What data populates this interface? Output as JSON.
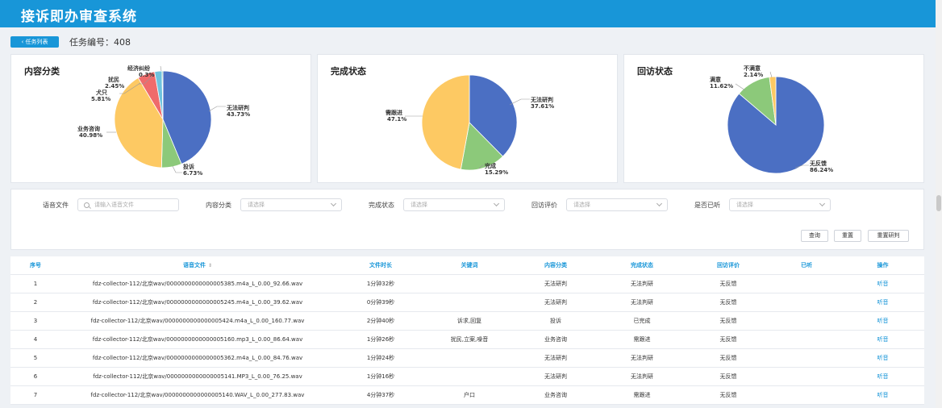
{
  "app": {
    "title": "接诉即办审查系统"
  },
  "toolbar": {
    "back_label": "任务列表",
    "back_icon": "chevron-left-icon",
    "task_id_label": "任务编号：408"
  },
  "colors": {
    "primary": "#1896d8",
    "blue": "#4b6fc3",
    "green": "#8cc97a",
    "yellow": "#fdc963",
    "red": "#ef6b6b",
    "cyan": "#6fc3de"
  },
  "charts": [
    {
      "title": "内容分类",
      "labels": [
        {
          "name": "无法研判",
          "pct": "43.73%"
        },
        {
          "name": "投诉",
          "pct": "6.73%"
        },
        {
          "name": "业务咨询",
          "pct": "40.98%"
        },
        {
          "name": "犬只",
          "pct": "5.81%"
        },
        {
          "name": "扰民",
          "pct": "2.45%"
        },
        {
          "name": "经济纠纷",
          "pct": "0.3%"
        }
      ]
    },
    {
      "title": "完成状态",
      "labels": [
        {
          "name": "无法研判",
          "pct": "37.61%"
        },
        {
          "name": "完成",
          "pct": "15.29%"
        },
        {
          "name": "需跟进",
          "pct": "47.1%"
        }
      ]
    },
    {
      "title": "回访状态",
      "labels": [
        {
          "name": "无反馈",
          "pct": "86.24%"
        },
        {
          "name": "满意",
          "pct": "11.62%"
        },
        {
          "name": "不满意",
          "pct": "2.14%"
        }
      ]
    }
  ],
  "chart_data": [
    {
      "type": "pie",
      "title": "内容分类",
      "slices": [
        {
          "label": "无法研判",
          "value": 43.73,
          "color": "#4b6fc3"
        },
        {
          "label": "投诉",
          "value": 6.73,
          "color": "#8cc97a"
        },
        {
          "label": "业务咨询",
          "value": 40.98,
          "color": "#fdc963"
        },
        {
          "label": "犬只",
          "value": 5.81,
          "color": "#ef6b6b"
        },
        {
          "label": "扰民",
          "value": 2.45,
          "color": "#6fc3de"
        },
        {
          "label": "经济纠纷",
          "value": 0.3,
          "color": "#3ba272"
        }
      ]
    },
    {
      "type": "pie",
      "title": "完成状态",
      "slices": [
        {
          "label": "无法研判",
          "value": 37.61,
          "color": "#4b6fc3"
        },
        {
          "label": "完成",
          "value": 15.29,
          "color": "#8cc97a"
        },
        {
          "label": "需跟进",
          "value": 47.1,
          "color": "#fdc963"
        }
      ]
    },
    {
      "type": "pie",
      "title": "回访状态",
      "slices": [
        {
          "label": "无反馈",
          "value": 86.24,
          "color": "#4b6fc3"
        },
        {
          "label": "满意",
          "value": 11.62,
          "color": "#8cc97a"
        },
        {
          "label": "不满意",
          "value": 2.14,
          "color": "#fdc963"
        }
      ]
    }
  ],
  "filters": {
    "audio_label": "语音文件",
    "audio_placeholder": "请输入语音文件",
    "category_label": "内容分类",
    "category_placeholder": "请选择",
    "status_label": "完成状态",
    "status_placeholder": "请选择",
    "visit_label": "回访评价",
    "visit_placeholder": "请选择",
    "listened_label": "是否已听",
    "listened_placeholder": "请选择",
    "query_label": "查询",
    "reset_label": "重置",
    "reset_judge_label": "重置研判"
  },
  "table": {
    "headers": [
      "序号",
      "语音文件",
      "文件时长",
      "关键词",
      "内容分类",
      "完成状态",
      "回访评价",
      "已听",
      "操作"
    ],
    "rows": [
      {
        "no": "1",
        "file": "fdz-collector-112/北京wav/0000000000000005385.m4a_L_0.00_92.66.wav",
        "duration": "1分钟32秒",
        "keywords": "",
        "category": "无法研判",
        "status": "无法判研",
        "visit": "无反馈",
        "listened": "",
        "action": "听音"
      },
      {
        "no": "2",
        "file": "fdz-collector-112/北京wav/0000000000000005245.m4a_L_0.00_39.62.wav",
        "duration": "0分钟39秒",
        "keywords": "",
        "category": "无法研判",
        "status": "无法判研",
        "visit": "无反馈",
        "listened": "",
        "action": "听音"
      },
      {
        "no": "3",
        "file": "fdz-collector-112/北京wav/0000000000000005424.m4a_L_0.00_160.77.wav",
        "duration": "2分钟40秒",
        "keywords": "诉求,回复",
        "category": "投诉",
        "status": "已完成",
        "visit": "无反馈",
        "listened": "",
        "action": "听音"
      },
      {
        "no": "4",
        "file": "fdz-collector-112/北京wav/0000000000000005160.mp3_L_0.00_86.64.wav",
        "duration": "1分钟26秒",
        "keywords": "扰民,立案,噪音",
        "category": "业务咨询",
        "status": "需跟进",
        "visit": "无反馈",
        "listened": "",
        "action": "听音"
      },
      {
        "no": "5",
        "file": "fdz-collector-112/北京wav/0000000000000005362.m4a_L_0.00_84.76.wav",
        "duration": "1分钟24秒",
        "keywords": "",
        "category": "无法研判",
        "status": "无法判研",
        "visit": "无反馈",
        "listened": "",
        "action": "听音"
      },
      {
        "no": "6",
        "file": "fdz-collector-112/北京wav/0000000000000005141.MP3_L_0.00_76.25.wav",
        "duration": "1分钟16秒",
        "keywords": "",
        "category": "无法研判",
        "status": "无法判研",
        "visit": "无反馈",
        "listened": "",
        "action": "听音"
      },
      {
        "no": "7",
        "file": "fdz-collector-112/北京wav/0000000000000005140.WAV_L_0.00_277.83.wav",
        "duration": "4分钟37秒",
        "keywords": "户口",
        "category": "业务咨询",
        "status": "需跟进",
        "visit": "无反馈",
        "listened": "",
        "action": "听音"
      }
    ]
  }
}
